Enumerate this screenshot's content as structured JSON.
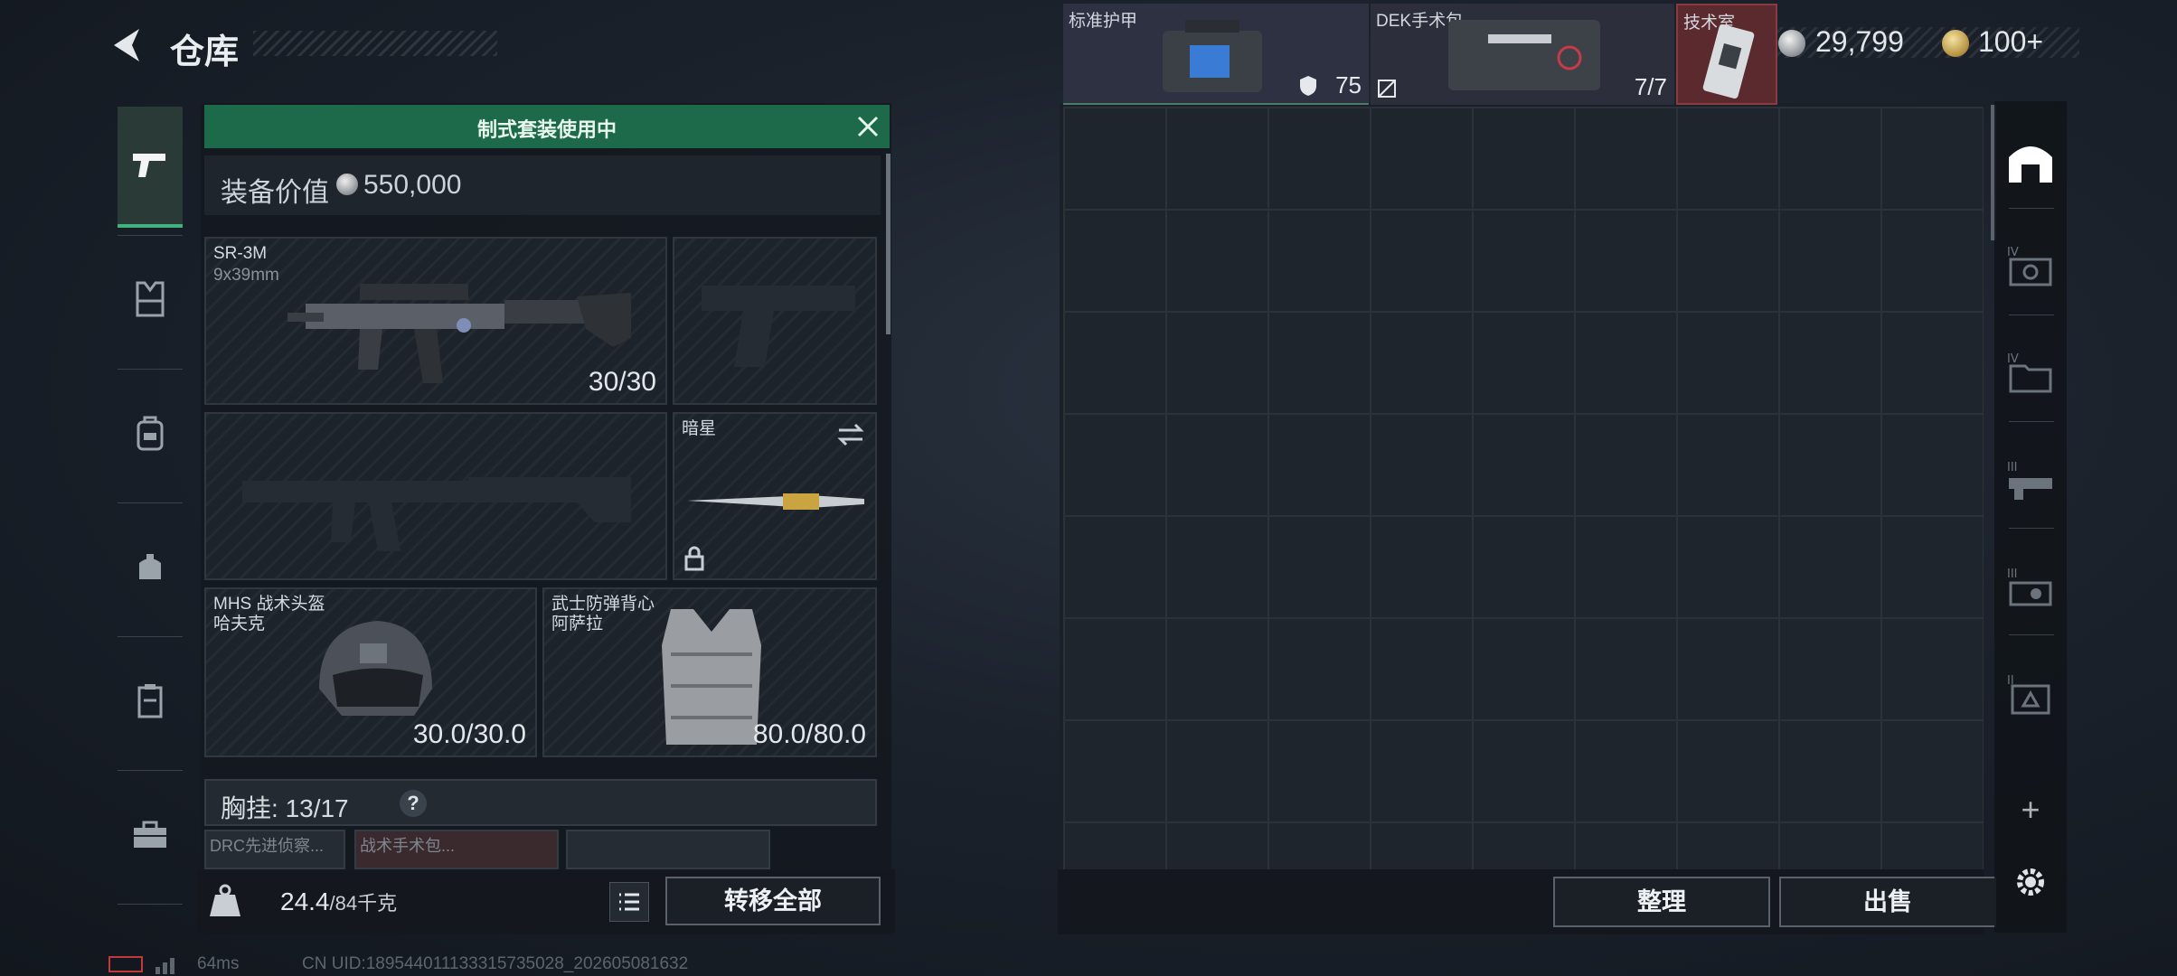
{
  "header": {
    "title": "仓库",
    "currency_silver": "29,799",
    "currency_gold": "100+",
    "back_icon": "back-arrow-icon"
  },
  "sidebar": {
    "items": [
      {
        "icon": "pistol-icon",
        "active": true
      },
      {
        "icon": "vest-icon"
      },
      {
        "icon": "backpack-icon"
      },
      {
        "icon": "pouch-icon"
      },
      {
        "icon": "container-icon"
      },
      {
        "icon": "toolbox-icon"
      }
    ]
  },
  "loadout": {
    "banner": "制式套装使用中",
    "equip_label": "装备价值",
    "equip_value": "550,000",
    "primary": {
      "name": "SR-3M",
      "caliber": "9x39mm",
      "ammo": "30/30"
    },
    "melee": {
      "name": "暗星"
    },
    "helmet": {
      "name": "MHS 战术头盔",
      "sub": "哈夫克",
      "durability": "30.0/30.0"
    },
    "armor": {
      "name": "武士防弹背心",
      "sub": "阿萨拉",
      "durability": "80.0/80.0"
    },
    "chest": {
      "label": "胸挂:",
      "capacity": "13/17",
      "help": "?"
    },
    "mini_items": [
      "DRC先进侦察...",
      "战术手术包..."
    ],
    "weight": "24.4",
    "weight_max": "/84千克",
    "transfer_all": "转移全部"
  },
  "stash": {
    "items": [
      {
        "name": "标准护甲",
        "count": "75"
      },
      {
        "name": "DEK手术包",
        "count": "7/7"
      },
      {
        "name": "技术室"
      }
    ],
    "sort": "整理",
    "sell": "出售"
  },
  "right_tabs": [
    {
      "icon": "stash-home-icon",
      "label": ""
    },
    {
      "icon": "tier-iv-case-icon",
      "label": "IV"
    },
    {
      "icon": "tier-iv-folder-icon",
      "label": "IV"
    },
    {
      "icon": "tier-iii-weapon-case-icon",
      "label": "III"
    },
    {
      "icon": "tier-iii-tool-icon",
      "label": "III"
    },
    {
      "icon": "tier-ii-box-icon",
      "label": "II"
    },
    {
      "icon": "plus-icon",
      "label": "+"
    },
    {
      "icon": "gear-icon",
      "label": ""
    }
  ],
  "status": {
    "ping": "64ms",
    "uid": "CN UID:1895440111333157350​28_202605081632"
  }
}
